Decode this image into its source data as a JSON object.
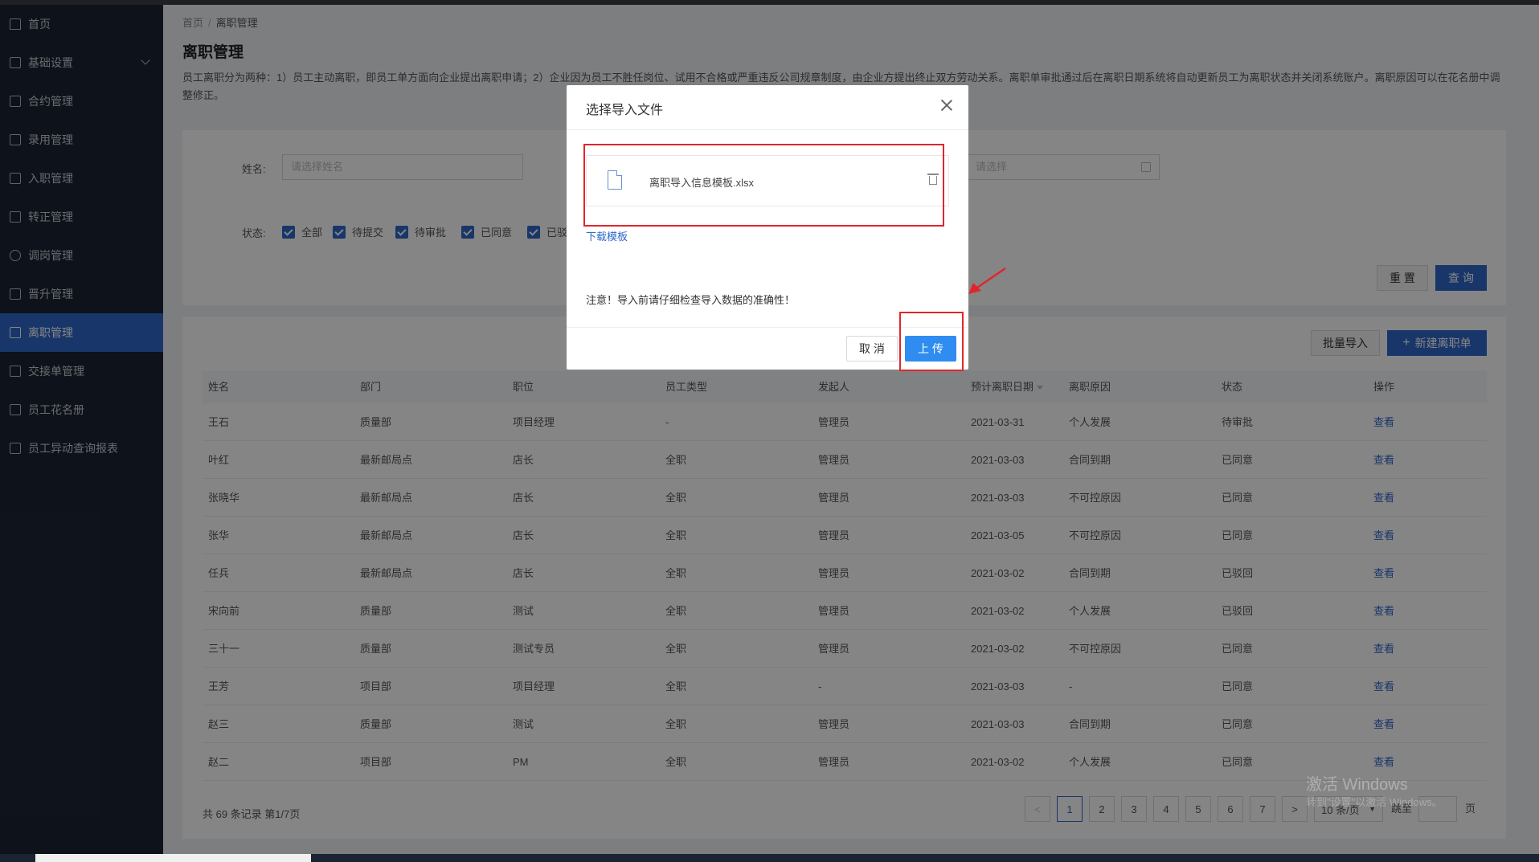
{
  "sidebar": {
    "items": [
      {
        "label": "首页",
        "icon": "home-icon"
      },
      {
        "label": "基础设置",
        "icon": "mail-icon"
      },
      {
        "label": "合约管理",
        "icon": "calendar-icon"
      },
      {
        "label": "录用管理",
        "icon": "list-icon"
      },
      {
        "label": "入职管理",
        "icon": "doc-icon"
      },
      {
        "label": "转正管理",
        "icon": "grid-icon"
      },
      {
        "label": "调岗管理",
        "icon": "user-icon"
      },
      {
        "label": "晋升管理",
        "icon": "chart-icon"
      },
      {
        "label": "离职管理",
        "icon": "leave-icon"
      },
      {
        "label": "交接单管理",
        "icon": "copy-icon"
      },
      {
        "label": "员工花名册",
        "icon": "book-icon"
      },
      {
        "label": "员工异动查询报表",
        "icon": "report-icon"
      }
    ],
    "active_index": 8
  },
  "breadcrumb": {
    "home": "首页",
    "sep": "/",
    "current": "离职管理"
  },
  "page": {
    "title": "离职管理",
    "desc": "员工离职分为两种：1）员工主动离职，即员工单方面向企业提出离职申请；2）企业因为员工不胜任岗位、试用不合格或严重违反公司规章制度，由企业方提出终止双方劳动关系。离职单审批通过后在离职日期系统将自动更新员工为离职状态并关闭系统账户。离职原因可以在花名册中调整修正。"
  },
  "filter": {
    "name_label": "姓名:",
    "name_placeholder": "请选择姓名",
    "date_placeholder": "请选择",
    "status_label": "状态:",
    "statuses": [
      "全部",
      "待提交",
      "待审批",
      "已同意",
      "已驳"
    ],
    "reset": "重 置",
    "query": "查 询"
  },
  "toolbar": {
    "batch_import": "批量导入",
    "new_leave": "新建离职单"
  },
  "table": {
    "headers": [
      "姓名",
      "部门",
      "职位",
      "员工类型",
      "发起人",
      "预计离职日期",
      "离职原因",
      "状态",
      "操作"
    ],
    "rows": [
      [
        "王石",
        "质量部",
        "项目经理",
        "-",
        "管理员",
        "2021-03-31",
        "个人发展",
        "待审批",
        "查看"
      ],
      [
        "叶红",
        "最新邮局点",
        "店长",
        "全职",
        "管理员",
        "2021-03-03",
        "合同到期",
        "已同意",
        "查看"
      ],
      [
        "张晓华",
        "最新邮局点",
        "店长",
        "全职",
        "管理员",
        "2021-03-03",
        "不可控原因",
        "已同意",
        "查看"
      ],
      [
        "张华",
        "最新邮局点",
        "店长",
        "全职",
        "管理员",
        "2021-03-05",
        "不可控原因",
        "已同意",
        "查看"
      ],
      [
        "任兵",
        "最新邮局点",
        "店长",
        "全职",
        "管理员",
        "2021-03-02",
        "合同到期",
        "已驳回",
        "查看"
      ],
      [
        "宋向前",
        "质量部",
        "测试",
        "全职",
        "管理员",
        "2021-03-02",
        "个人发展",
        "已驳回",
        "查看"
      ],
      [
        "三十一",
        "质量部",
        "测试专员",
        "全职",
        "管理员",
        "2021-03-02",
        "不可控原因",
        "已同意",
        "查看"
      ],
      [
        "王芳",
        "项目部",
        "项目经理",
        "全职",
        "-",
        "2021-03-03",
        "-",
        "已同意",
        "查看"
      ],
      [
        "赵三",
        "质量部",
        "测试",
        "全职",
        "管理员",
        "2021-03-03",
        "合同到期",
        "已同意",
        "查看"
      ],
      [
        "赵二",
        "项目部",
        "PM",
        "全职",
        "管理员",
        "2021-03-02",
        "个人发展",
        "已同意",
        "查看"
      ]
    ]
  },
  "pagination": {
    "summary": "共 69 条记录 第1/7页",
    "pages": [
      "1",
      "2",
      "3",
      "4",
      "5",
      "6",
      "7"
    ],
    "prev": "<",
    "next": ">",
    "page_size": "10 条/页",
    "jump_label": "跳至",
    "page_unit": "页"
  },
  "modal": {
    "title": "选择导入文件",
    "file_name": "离职导入信息模板.xlsx",
    "download_link": "下载模板",
    "notice": "注意！导入前请仔细检查导入数据的准确性！",
    "cancel": "取 消",
    "upload": "上 传"
  },
  "watermark": {
    "line1": "激活 Windows",
    "line2": "转到\"设置\"以激活 Windows。"
  },
  "colors": {
    "primary": "#2f68c9",
    "sidebar": "#1c2433",
    "annotation": "#e0262b"
  }
}
